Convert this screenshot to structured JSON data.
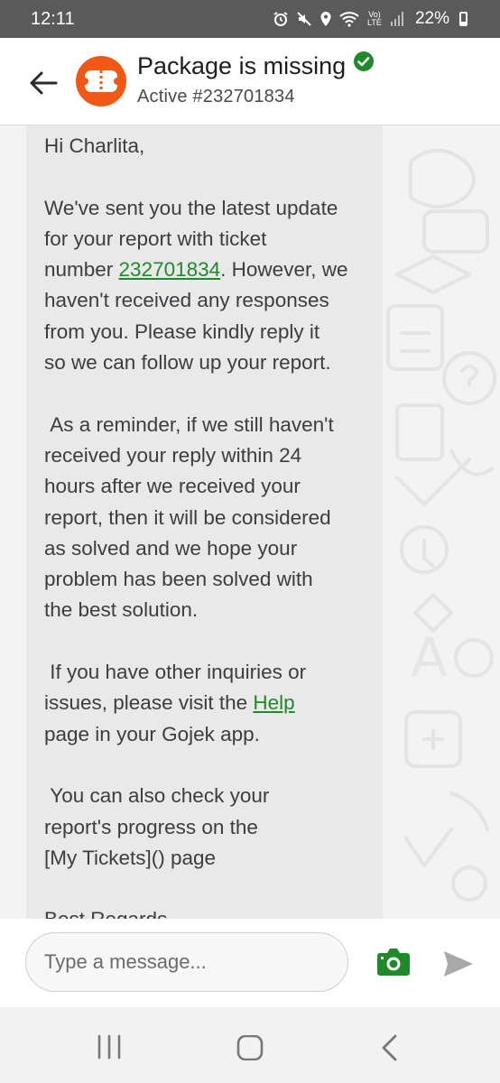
{
  "status_bar": {
    "time": "12:11",
    "battery": "22%",
    "network": "Vo) LTE"
  },
  "header": {
    "title": "Package is missing",
    "subtitle": "Active #232701834"
  },
  "message": {
    "greeting": "Hi Charlita,",
    "p1_before": "We've sent you the latest update\nfor your report with ticket\nnumber ",
    "ticket_link": "232701834",
    "p1_after": ". However, we\nhaven't received any responses\nfrom you. Please kindly reply it\nso we can follow up your report.",
    "p2": " As a reminder, if we still haven't\nreceived your reply within 24\nhours after we received your\nreport, then it will be considered\nas solved and we hope your\nproblem has been solved with\nthe best solution.",
    "p3_before": " If you have other inquiries or\nissues, please visit the ",
    "help_link": "Help",
    "p3_after": "\npage in your Gojek app.",
    "p4": " You can also check your\nreport's progress on the\n[My Tickets]() page",
    "closing": "Best Regards"
  },
  "composer": {
    "placeholder": "Type a message..."
  },
  "colors": {
    "accent_green": "#1f8a2a",
    "avatar_orange": "#ee5a16",
    "status_bar": "#5a5a5a"
  },
  "icons": [
    "back-arrow-icon",
    "gojek-logo-icon",
    "verified-check-icon",
    "camera-icon",
    "send-icon",
    "recent-apps-icon",
    "home-icon",
    "nav-back-icon"
  ]
}
